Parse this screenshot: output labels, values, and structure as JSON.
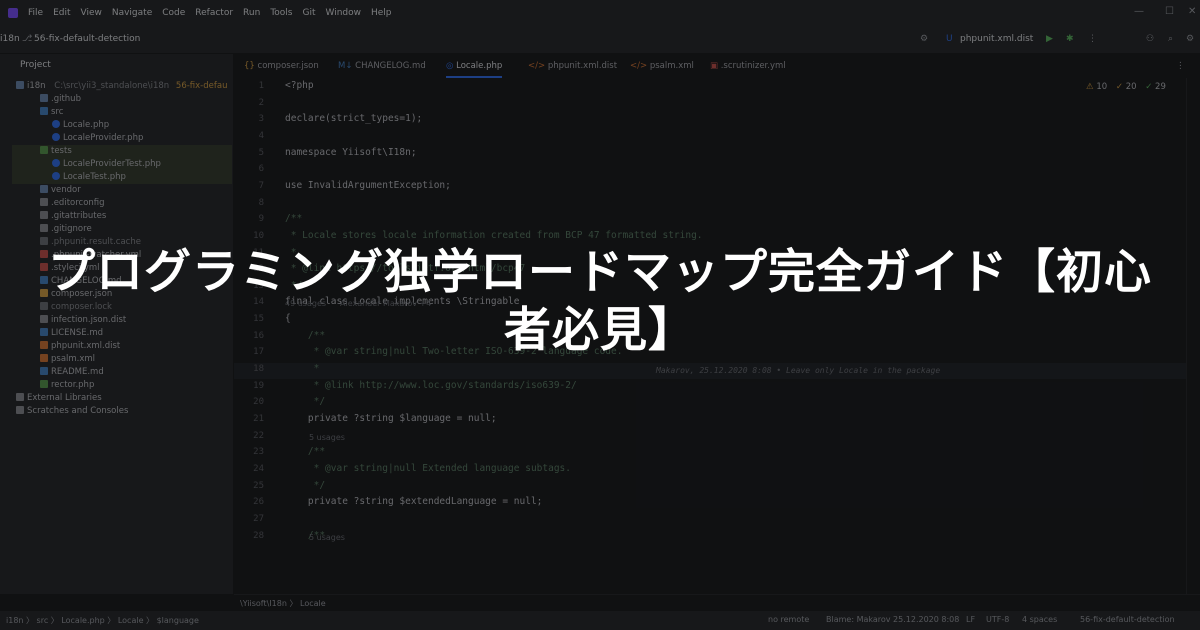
{
  "menu": [
    "File",
    "Edit",
    "View",
    "Navigate",
    "Code",
    "Refactor",
    "Run",
    "Tools",
    "Git",
    "Window",
    "Help"
  ],
  "toolbar": {
    "project": "i18n",
    "branch": "56-fix-default-detection",
    "run_config": "phpunit.xml.dist"
  },
  "project_panel": {
    "title": "Project",
    "rows": [
      {
        "label": "i18n",
        "path": "C:\\src\\yii3_standalone\\i18n",
        "branch": "56-fix-defau"
      },
      {
        "label": ".github"
      },
      {
        "label": "src"
      },
      {
        "label": "Locale.php"
      },
      {
        "label": "LocaleProvider.php"
      },
      {
        "label": "tests"
      },
      {
        "label": "LocaleProviderTest.php"
      },
      {
        "label": "LocaleTest.php"
      },
      {
        "label": "vendor"
      },
      {
        "label": ".editorconfig"
      },
      {
        "label": ".gitattributes"
      },
      {
        "label": ".gitignore"
      },
      {
        "label": ".phpunit.result.cache"
      },
      {
        "label": ".phpunit-watcher.yml"
      },
      {
        "label": ".styleci.yml"
      },
      {
        "label": "CHANGELOG.md"
      },
      {
        "label": "composer.json"
      },
      {
        "label": "composer.lock"
      },
      {
        "label": "infection.json.dist"
      },
      {
        "label": "LICENSE.md"
      },
      {
        "label": "phpunit.xml.dist"
      },
      {
        "label": "psalm.xml"
      },
      {
        "label": "README.md"
      },
      {
        "label": "rector.php"
      },
      {
        "label": "External Libraries"
      },
      {
        "label": "Scratches and Consoles"
      }
    ]
  },
  "tabs": [
    "composer.json",
    "CHANGELOG.md",
    "Locale.php",
    "phpunit.xml.dist",
    "psalm.xml",
    ".scrutinizer.yml"
  ],
  "inspections": {
    "warnings": "10",
    "weak": "20",
    "typos": "29"
  },
  "code_lines": [
    {
      "n": "1",
      "text": "<?php"
    },
    {
      "n": "2",
      "text": ""
    },
    {
      "n": "3",
      "text": "declare(strict_types=1);"
    },
    {
      "n": "4",
      "text": ""
    },
    {
      "n": "5",
      "text": "namespace Yiisoft\\I18n;"
    },
    {
      "n": "6",
      "text": ""
    },
    {
      "n": "7",
      "text": "use InvalidArgumentException;"
    },
    {
      "n": "8",
      "text": ""
    },
    {
      "n": "9",
      "text": "/**"
    },
    {
      "n": "10",
      "text": " * Locale stores locale information created from BCP 47 formatted string."
    },
    {
      "n": "11",
      "text": " *"
    },
    {
      "n": "12",
      "text": " * @link https://tools.ietf.org/html/bcp47"
    },
    {
      "n": "13",
      "text": " */"
    },
    {
      "n": "14",
      "text": "final class Locale implements \\Stringable"
    },
    {
      "n": "15",
      "text": "{"
    },
    {
      "n": "16",
      "text": "    /**"
    },
    {
      "n": "17",
      "text": "     * @var string|null Two-letter ISO-639-2 language code."
    },
    {
      "n": "18",
      "text": "     *"
    },
    {
      "n": "19",
      "text": "     * @link http://www.loc.gov/standards/iso639-2/"
    },
    {
      "n": "20",
      "text": "     */"
    },
    {
      "n": "21",
      "text": "    private ?string $language = null;"
    },
    {
      "n": "22",
      "text": ""
    },
    {
      "n": "23",
      "text": "    /**"
    },
    {
      "n": "24",
      "text": "     * @var string|null Extended language subtags."
    },
    {
      "n": "25",
      "text": "     */"
    },
    {
      "n": "26",
      "text": "    private ?string $extendedLanguage = null;"
    },
    {
      "n": "27",
      "text": ""
    },
    {
      "n": "28",
      "text": "    /**"
    }
  ],
  "hints": {
    "usages_class": "49 usages",
    "author_class": "Alexander Makarov +4",
    "usages_20": "5 usages",
    "usages_25": "5 usages",
    "blame_line": "Makarov, 25.12.2020 8:08 • Leave only Locale in the package"
  },
  "breadcrumb": "\\Yiisoft\\I18n  〉 Locale",
  "statusbar": {
    "path": "i18n 〉 src 〉 Locale.php 〉 Locale 〉 $language",
    "no_remote": "no remote",
    "blame": "Blame: Makarov 25.12.2020 8:08",
    "line_sep": "LF",
    "encoding": "UTF-8",
    "indent": "4 spaces",
    "branch": "56-fix-default-detection"
  },
  "headline": {
    "line1": "プログラミング独学ロードマップ完全ガイド【初心",
    "line2": "者必見】"
  }
}
